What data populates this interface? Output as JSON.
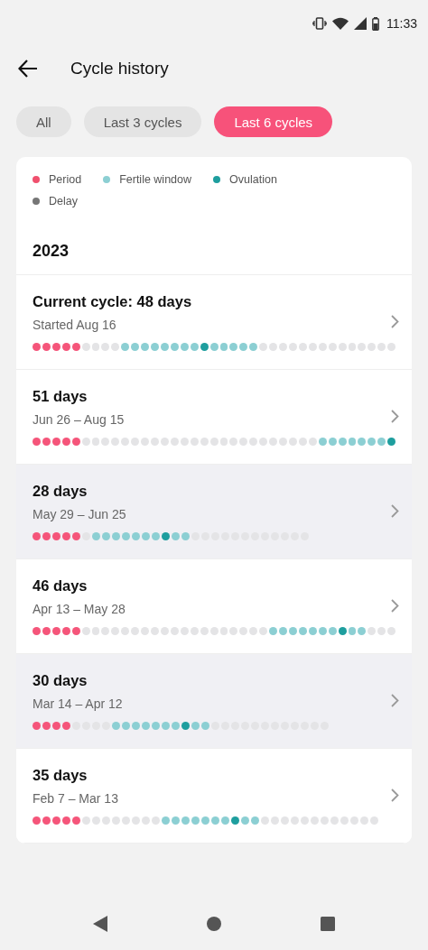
{
  "status_bar": {
    "time": "11:33"
  },
  "header": {
    "title": "Cycle history"
  },
  "filters": [
    {
      "label": "All",
      "selected": false
    },
    {
      "label": "Last 3 cycles",
      "selected": false
    },
    {
      "label": "Last 6 cycles",
      "selected": true
    }
  ],
  "legend": [
    {
      "label": "Period",
      "color": "#f0506e"
    },
    {
      "label": "Fertile window",
      "color": "#8ccfd3"
    },
    {
      "label": "Ovulation",
      "color": "#1e9e9e"
    },
    {
      "label": "Delay",
      "color": "#767676"
    }
  ],
  "year": "2023",
  "cycles": [
    {
      "title": "Current cycle: 48 days",
      "dates": "Started Aug 16",
      "highlighted": false,
      "days": [
        {
          "kind": "period"
        },
        {
          "kind": "period"
        },
        {
          "kind": "period"
        },
        {
          "kind": "period"
        },
        {
          "kind": "period"
        },
        {
          "kind": "none"
        },
        {
          "kind": "none"
        },
        {
          "kind": "none"
        },
        {
          "kind": "none"
        },
        {
          "kind": "fertile"
        },
        {
          "kind": "fertile"
        },
        {
          "kind": "fertile"
        },
        {
          "kind": "fertile"
        },
        {
          "kind": "fertile"
        },
        {
          "kind": "fertile"
        },
        {
          "kind": "fertile"
        },
        {
          "kind": "fertile"
        },
        {
          "kind": "ovulation"
        },
        {
          "kind": "fertile"
        },
        {
          "kind": "fertile"
        },
        {
          "kind": "fertile"
        },
        {
          "kind": "fertile"
        },
        {
          "kind": "fertile"
        },
        {
          "kind": "none"
        },
        {
          "kind": "none"
        },
        {
          "kind": "none"
        },
        {
          "kind": "none"
        },
        {
          "kind": "none"
        },
        {
          "kind": "none"
        },
        {
          "kind": "none"
        },
        {
          "kind": "none"
        },
        {
          "kind": "none"
        },
        {
          "kind": "none"
        },
        {
          "kind": "none"
        },
        {
          "kind": "none"
        },
        {
          "kind": "none"
        },
        {
          "kind": "none"
        }
      ]
    },
    {
      "title": "51 days",
      "dates": "Jun 26 – Aug 15",
      "highlighted": false,
      "days": [
        {
          "kind": "period"
        },
        {
          "kind": "period"
        },
        {
          "kind": "period"
        },
        {
          "kind": "period"
        },
        {
          "kind": "period"
        },
        {
          "kind": "none"
        },
        {
          "kind": "none"
        },
        {
          "kind": "none"
        },
        {
          "kind": "none"
        },
        {
          "kind": "none"
        },
        {
          "kind": "none"
        },
        {
          "kind": "none"
        },
        {
          "kind": "none"
        },
        {
          "kind": "none"
        },
        {
          "kind": "none"
        },
        {
          "kind": "none"
        },
        {
          "kind": "none"
        },
        {
          "kind": "none"
        },
        {
          "kind": "none"
        },
        {
          "kind": "none"
        },
        {
          "kind": "none"
        },
        {
          "kind": "none"
        },
        {
          "kind": "none"
        },
        {
          "kind": "none"
        },
        {
          "kind": "none"
        },
        {
          "kind": "none"
        },
        {
          "kind": "none"
        },
        {
          "kind": "none"
        },
        {
          "kind": "none"
        },
        {
          "kind": "fertile"
        },
        {
          "kind": "fertile"
        },
        {
          "kind": "fertile"
        },
        {
          "kind": "fertile"
        },
        {
          "kind": "fertile"
        },
        {
          "kind": "fertile"
        },
        {
          "kind": "fertile"
        },
        {
          "kind": "ovulation"
        }
      ]
    },
    {
      "title": "28 days",
      "dates": "May 29 – Jun 25",
      "highlighted": true,
      "days": [
        {
          "kind": "period"
        },
        {
          "kind": "period"
        },
        {
          "kind": "period"
        },
        {
          "kind": "period"
        },
        {
          "kind": "period"
        },
        {
          "kind": "none"
        },
        {
          "kind": "fertile"
        },
        {
          "kind": "fertile"
        },
        {
          "kind": "fertile"
        },
        {
          "kind": "fertile"
        },
        {
          "kind": "fertile"
        },
        {
          "kind": "fertile"
        },
        {
          "kind": "fertile"
        },
        {
          "kind": "ovulation"
        },
        {
          "kind": "fertile"
        },
        {
          "kind": "fertile"
        },
        {
          "kind": "none"
        },
        {
          "kind": "none"
        },
        {
          "kind": "none"
        },
        {
          "kind": "none"
        },
        {
          "kind": "none"
        },
        {
          "kind": "none"
        },
        {
          "kind": "none"
        },
        {
          "kind": "none"
        },
        {
          "kind": "none"
        },
        {
          "kind": "none"
        },
        {
          "kind": "none"
        },
        {
          "kind": "none"
        }
      ]
    },
    {
      "title": "46 days",
      "dates": "Apr 13 – May 28",
      "highlighted": false,
      "days": [
        {
          "kind": "period"
        },
        {
          "kind": "period"
        },
        {
          "kind": "period"
        },
        {
          "kind": "period"
        },
        {
          "kind": "period"
        },
        {
          "kind": "none"
        },
        {
          "kind": "none"
        },
        {
          "kind": "none"
        },
        {
          "kind": "none"
        },
        {
          "kind": "none"
        },
        {
          "kind": "none"
        },
        {
          "kind": "none"
        },
        {
          "kind": "none"
        },
        {
          "kind": "none"
        },
        {
          "kind": "none"
        },
        {
          "kind": "none"
        },
        {
          "kind": "none"
        },
        {
          "kind": "none"
        },
        {
          "kind": "none"
        },
        {
          "kind": "none"
        },
        {
          "kind": "none"
        },
        {
          "kind": "none"
        },
        {
          "kind": "none"
        },
        {
          "kind": "none"
        },
        {
          "kind": "fertile"
        },
        {
          "kind": "fertile"
        },
        {
          "kind": "fertile"
        },
        {
          "kind": "fertile"
        },
        {
          "kind": "fertile"
        },
        {
          "kind": "fertile"
        },
        {
          "kind": "fertile"
        },
        {
          "kind": "ovulation"
        },
        {
          "kind": "fertile"
        },
        {
          "kind": "fertile"
        },
        {
          "kind": "none"
        },
        {
          "kind": "none"
        },
        {
          "kind": "none"
        }
      ]
    },
    {
      "title": "30 days",
      "dates": "Mar 14 – Apr 12",
      "highlighted": true,
      "days": [
        {
          "kind": "period"
        },
        {
          "kind": "period"
        },
        {
          "kind": "period"
        },
        {
          "kind": "period"
        },
        {
          "kind": "none"
        },
        {
          "kind": "none"
        },
        {
          "kind": "none"
        },
        {
          "kind": "none"
        },
        {
          "kind": "fertile"
        },
        {
          "kind": "fertile"
        },
        {
          "kind": "fertile"
        },
        {
          "kind": "fertile"
        },
        {
          "kind": "fertile"
        },
        {
          "kind": "fertile"
        },
        {
          "kind": "fertile"
        },
        {
          "kind": "ovulation"
        },
        {
          "kind": "fertile"
        },
        {
          "kind": "fertile"
        },
        {
          "kind": "none"
        },
        {
          "kind": "none"
        },
        {
          "kind": "none"
        },
        {
          "kind": "none"
        },
        {
          "kind": "none"
        },
        {
          "kind": "none"
        },
        {
          "kind": "none"
        },
        {
          "kind": "none"
        },
        {
          "kind": "none"
        },
        {
          "kind": "none"
        },
        {
          "kind": "none"
        },
        {
          "kind": "none"
        }
      ]
    },
    {
      "title": "35 days",
      "dates": "Feb 7 – Mar 13",
      "highlighted": false,
      "days": [
        {
          "kind": "period"
        },
        {
          "kind": "period"
        },
        {
          "kind": "period"
        },
        {
          "kind": "period"
        },
        {
          "kind": "period"
        },
        {
          "kind": "none"
        },
        {
          "kind": "none"
        },
        {
          "kind": "none"
        },
        {
          "kind": "none"
        },
        {
          "kind": "none"
        },
        {
          "kind": "none"
        },
        {
          "kind": "none"
        },
        {
          "kind": "none"
        },
        {
          "kind": "fertile"
        },
        {
          "kind": "fertile"
        },
        {
          "kind": "fertile"
        },
        {
          "kind": "fertile"
        },
        {
          "kind": "fertile"
        },
        {
          "kind": "fertile"
        },
        {
          "kind": "fertile"
        },
        {
          "kind": "ovulation"
        },
        {
          "kind": "fertile"
        },
        {
          "kind": "fertile"
        },
        {
          "kind": "none"
        },
        {
          "kind": "none"
        },
        {
          "kind": "none"
        },
        {
          "kind": "none"
        },
        {
          "kind": "none"
        },
        {
          "kind": "none"
        },
        {
          "kind": "none"
        },
        {
          "kind": "none"
        },
        {
          "kind": "none"
        },
        {
          "kind": "none"
        },
        {
          "kind": "none"
        },
        {
          "kind": "none"
        }
      ]
    }
  ]
}
